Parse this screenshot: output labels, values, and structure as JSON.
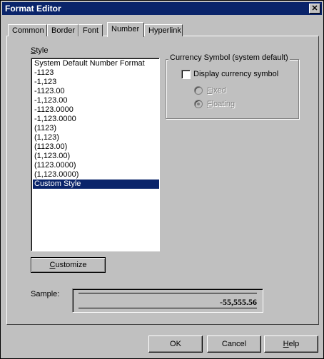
{
  "window": {
    "title": "Format Editor",
    "close_glyph": "✕"
  },
  "tabs": [
    {
      "label": "Common"
    },
    {
      "label": "Border"
    },
    {
      "label": "Font"
    },
    {
      "label": "Number",
      "active": true
    },
    {
      "label": "Hyperlink"
    }
  ],
  "style": {
    "label_underlined": "S",
    "label_rest": "tyle",
    "items": [
      "System Default Number Format",
      "-1123",
      "-1,123",
      "-1123.00",
      "-1,123.00",
      "-1123.0000",
      "-1,123.0000",
      "(1123)",
      "(1,123)",
      "(1123.00)",
      "(1,123.00)",
      "(1123.0000)",
      "(1,123.0000)",
      "Custom Style"
    ],
    "selected_index": 13
  },
  "currency": {
    "group_label": "Currency Symbol (system default)",
    "display_checkbox_label": "Display currency symbol",
    "display_checkbox_checked": false,
    "fixed_underlined": "F",
    "fixed_rest": "ixed",
    "floating_underlined": "F",
    "floating_rest": "loating"
  },
  "customize_button": {
    "underlined": "C",
    "rest": "ustomize"
  },
  "sample": {
    "label": "Sample:",
    "value": "-55,555.56"
  },
  "footer": {
    "ok": "OK",
    "cancel": "Cancel",
    "help_underlined": "H",
    "help_rest": "elp"
  },
  "colors": {
    "titlebar": "#0a246a",
    "selection": "#0a246a",
    "face": "#c0c0c0"
  }
}
